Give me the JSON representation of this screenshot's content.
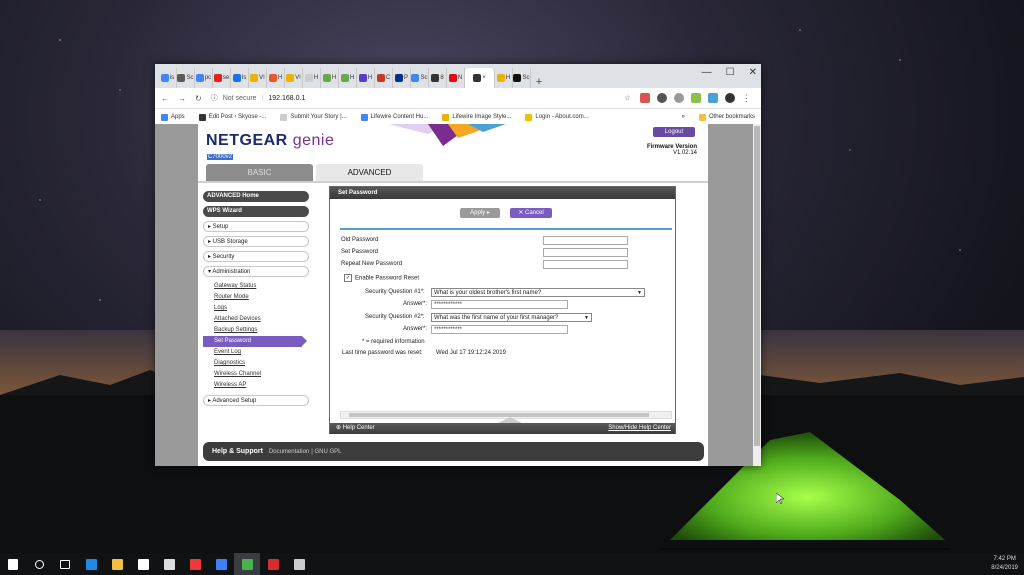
{
  "browser": {
    "tabs": [
      {
        "label": "is",
        "color": "#4285f4"
      },
      {
        "label": "Sc",
        "color": "#5a5a5a"
      },
      {
        "label": "pc",
        "color": "#4285f4"
      },
      {
        "label": "se",
        "color": "#e62117"
      },
      {
        "label": "Is",
        "color": "#1a73e8"
      },
      {
        "label": "V!",
        "color": "#e8b400"
      },
      {
        "label": "H",
        "color": "#e85a2a"
      },
      {
        "label": "V!",
        "color": "#e8b400"
      },
      {
        "label": "H",
        "color": "#cccccc"
      },
      {
        "label": "H",
        "color": "#6aa84f"
      },
      {
        "label": "H",
        "color": "#6aa84f"
      },
      {
        "label": "H",
        "color": "#5b3cc4"
      },
      {
        "label": "C",
        "color": "#c0392b"
      },
      {
        "label": "P",
        "color": "#003087"
      },
      {
        "label": "Sc",
        "color": "#4285f4"
      },
      {
        "label": "8",
        "color": "#333333"
      },
      {
        "label": "N",
        "color": "#e50914"
      },
      {
        "label": "×",
        "color": "#333333",
        "active": true
      },
      {
        "label": "H",
        "color": "#e8b400"
      },
      {
        "label": "Sc",
        "color": "#111111"
      }
    ],
    "new_tab": "+",
    "win_controls": {
      "minimize": "—",
      "maximize": "☐",
      "close": "✕"
    },
    "address": {
      "not_secure": "Not secure",
      "url": "192.168.0.1"
    },
    "bookmarks": [
      {
        "label": "Apps",
        "color": "#4285f4"
      },
      {
        "label": "Edit Post ‹ Skyose -...",
        "color": "#333333"
      },
      {
        "label": "Submit Your Story |...",
        "color": "#cccccc"
      },
      {
        "label": "Lifewire Content Hu...",
        "color": "#4285f4"
      },
      {
        "label": "Lifewire Image Style...",
        "color": "#e8b400"
      },
      {
        "label": "Login - About.com...",
        "color": "#f0c000"
      }
    ],
    "bookmarks_more": "»",
    "other_bookmarks": "Other bookmarks"
  },
  "router": {
    "logo_main": "NETGEAR",
    "logo_genie": "genie",
    "model": "C7000v2",
    "logout": "Logout",
    "firmware_label": "Firmware Version",
    "firmware_value": "V1.02.14",
    "tab_basic": "BASIC",
    "tab_advanced": "ADVANCED",
    "sidebar": {
      "advanced_home": "ADVANCED Home",
      "wps_wizard": "WPS Wizard",
      "setup": "▸ Setup",
      "usb_storage": "▸ USB Storage",
      "security": "▸ Security",
      "administration": "▾ Administration",
      "admin_items": [
        "Gateway Status",
        "Router Mode",
        "Logs",
        "Attached Devices",
        "Backup Settings",
        "Set Password",
        "Event Log",
        "Diagnostics",
        "Wireless Channel",
        "Wireless AP"
      ],
      "advanced_setup": "▸ Advanced Setup"
    },
    "panel": {
      "title": "Set Password",
      "apply": "Apply ▸",
      "cancel": "✕ Cancel",
      "old_password": "Old Password",
      "set_password": "Set Password",
      "repeat_password": "Repeat New Password",
      "enable_reset": "Enable Password Reset",
      "q1_label": "Security Question #1*:",
      "q1_value": "What is your oldest brother's first name?",
      "answer1_label": "Answer*:",
      "answer1_value": "************",
      "q2_label": "Security Question #2*:",
      "q2_value": "What was the first name of your first manager?",
      "answer2_label": "Answer*:",
      "answer2_value": "************",
      "required_info": "* = required information",
      "last_reset_label": "Last time password was reset:",
      "last_reset_value": "Wed Jul 17 19:12:24 2019",
      "help_center": "Help Center",
      "show_hide_help": "Show/Hide Help Center"
    },
    "help_bar": {
      "title": "Help & Support",
      "documentation": "Documentation",
      "gnu": "GNU GPL"
    }
  },
  "taskbar": {
    "icons": [
      {
        "name": "start-icon",
        "color": "#ffffff"
      },
      {
        "name": "search-icon",
        "color": "#ffffff"
      },
      {
        "name": "task-view-icon",
        "color": "#ffffff"
      },
      {
        "name": "edge-icon",
        "color": "#1e88e5"
      },
      {
        "name": "file-explorer-icon",
        "color": "#f0c040"
      },
      {
        "name": "store-icon",
        "color": "#ffffff"
      },
      {
        "name": "mail-icon",
        "color": "#dddddd"
      },
      {
        "name": "vivaldi-icon",
        "color": "#ef3939"
      },
      {
        "name": "flipboard-icon",
        "color": "#3b82f6"
      },
      {
        "name": "chrome-icon",
        "color": "#4caf50",
        "active": true
      },
      {
        "name": "app-red-icon",
        "color": "#d32f2f"
      },
      {
        "name": "printer-icon",
        "color": "#cccccc"
      }
    ],
    "time": "7:42 PM",
    "date": "8/24/2019"
  }
}
